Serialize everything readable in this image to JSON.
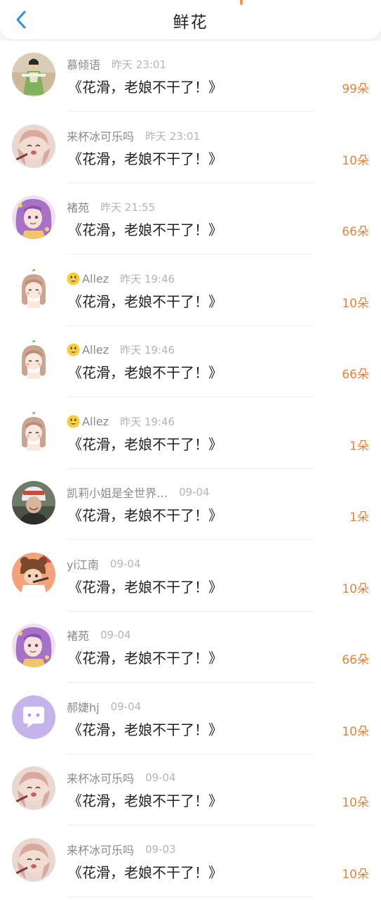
{
  "header": {
    "title": "鲜花",
    "back_icon": "chevron-left-icon",
    "accent": "#2b8ef0"
  },
  "colors": {
    "count": "#e8843a",
    "name": "#8a8a8a",
    "time": "#b4b4b4"
  },
  "records": [
    {
      "name": "慕倾语",
      "time": "昨天 23:01",
      "gift": "《花滑，老娘不干了！》",
      "count": "99朵",
      "avatar": "avatar-green-dress",
      "emoji": false
    },
    {
      "name": "来杯冰可乐吗",
      "time": "昨天 23:01",
      "gift": "《花滑，老娘不干了！》",
      "count": "10朵",
      "avatar": "avatar-anime-pink",
      "emoji": false
    },
    {
      "name": "褚苑",
      "time": "昨天 21:55",
      "gift": "《花滑，老娘不干了！》",
      "count": "66朵",
      "avatar": "avatar-anime-purple",
      "emoji": false
    },
    {
      "name": "Allez",
      "time": "昨天 19:46",
      "gift": "《花滑，老娘不干了！》",
      "count": "10朵",
      "avatar": "avatar-chibi-girl",
      "emoji": true
    },
    {
      "name": "Allez",
      "time": "昨天 19:46",
      "gift": "《花滑，老娘不干了！》",
      "count": "66朵",
      "avatar": "avatar-chibi-girl",
      "emoji": true
    },
    {
      "name": "Allez",
      "time": "昨天 19:46",
      "gift": "《花滑，老娘不干了！》",
      "count": "1朵",
      "avatar": "avatar-chibi-girl",
      "emoji": true
    },
    {
      "name": "凯莉小姐是全世界…",
      "time": "09-04",
      "gift": "《花滑，老娘不干了！》",
      "count": "1朵",
      "avatar": "avatar-helmet",
      "emoji": false
    },
    {
      "name": "yi江南",
      "time": "09-04",
      "gift": "《花滑，老娘不干了！》",
      "count": "10朵",
      "avatar": "avatar-cartoon-orange",
      "emoji": false
    },
    {
      "name": "褚苑",
      "time": "09-04",
      "gift": "《花滑，老娘不干了！》",
      "count": "66朵",
      "avatar": "avatar-anime-purple",
      "emoji": false
    },
    {
      "name": "郝婕hj",
      "time": "09-04",
      "gift": "《花滑，老娘不干了！》",
      "count": "10朵",
      "avatar": "avatar-default-chat",
      "emoji": false
    },
    {
      "name": "来杯冰可乐吗",
      "time": "09-04",
      "gift": "《花滑，老娘不干了！》",
      "count": "10朵",
      "avatar": "avatar-anime-pink",
      "emoji": false
    },
    {
      "name": "来杯冰可乐吗",
      "time": "09-03",
      "gift": "《花滑，老娘不干了！》",
      "count": "10朵",
      "avatar": "avatar-anime-pink",
      "emoji": false
    }
  ]
}
